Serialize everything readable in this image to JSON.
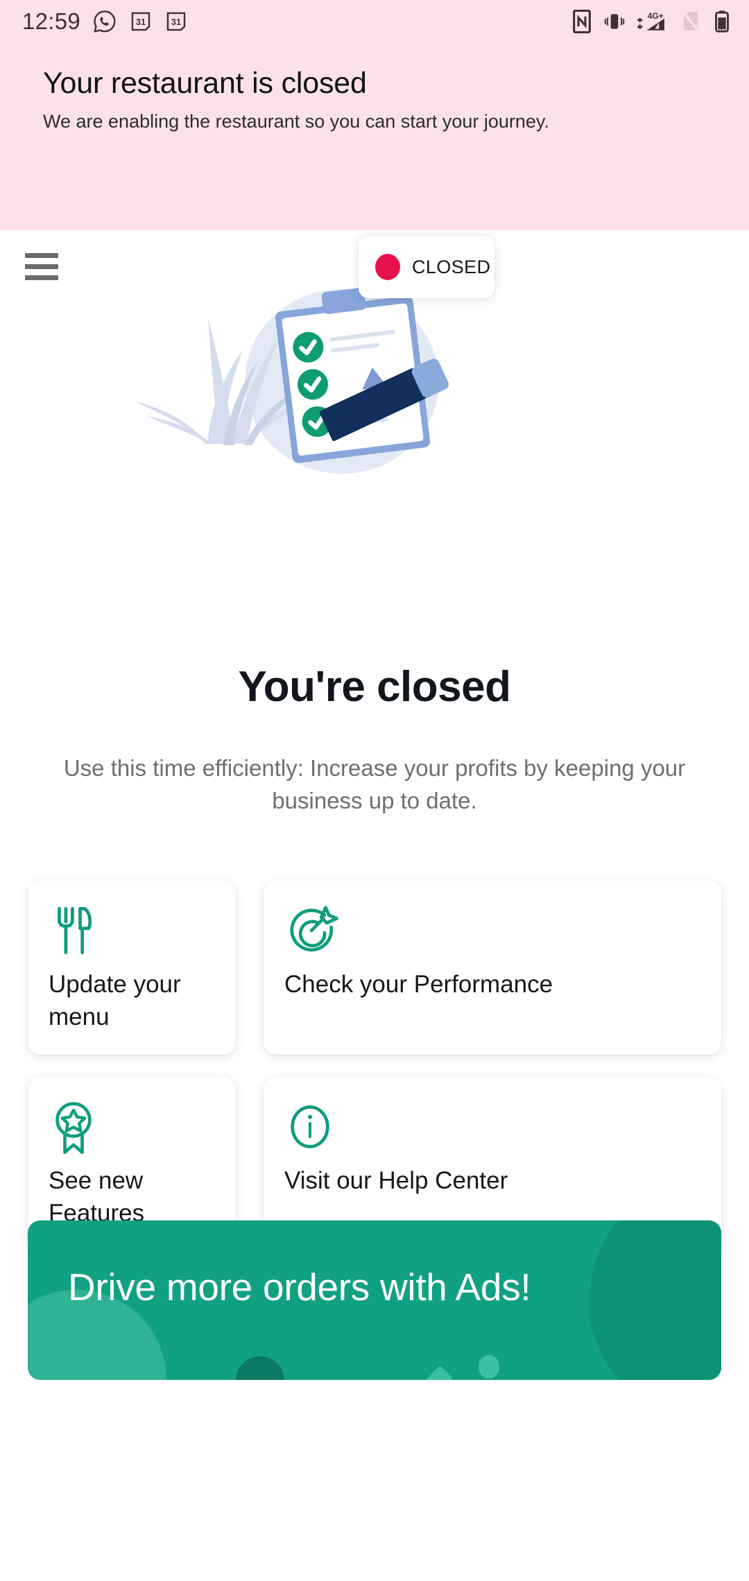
{
  "status_bar": {
    "time": "12:59",
    "left_icons": [
      {
        "name": "whatsapp-icon",
        "label": "WhatsApp"
      },
      {
        "name": "calendar-icon",
        "label": "31"
      },
      {
        "name": "calendar-icon-2",
        "label": "31"
      }
    ],
    "right_icons": [
      {
        "name": "nfc-icon",
        "label": "NFC"
      },
      {
        "name": "vibrate-icon",
        "label": "Vibrate"
      },
      {
        "name": "signal-4g-icon",
        "label": "4G+"
      },
      {
        "name": "no-sim-icon",
        "label": "No SIM"
      },
      {
        "name": "battery-icon",
        "label": "Battery"
      }
    ]
  },
  "banner": {
    "title": "Your restaurant is closed",
    "subtitle": "We are enabling the restaurant so you can start your journey.",
    "background_color": "#fbe1e9"
  },
  "header": {
    "menu_icon": "hamburger-menu-icon",
    "store_icon": "store-clock-icon",
    "status_pill": {
      "label": "CLOSED",
      "dot_color": "#e8114b"
    }
  },
  "illustration": {
    "name": "clipboard-checklist-illustration",
    "elements": [
      "plant",
      "clipboard",
      "three-green-checkmarks",
      "pencil"
    ],
    "accent_color": "#0c9a74",
    "blue_color": "#7a9bd4"
  },
  "main": {
    "title": "You're closed",
    "subtitle": "Use this time efficiently: Increase your profits by keeping your business up to date."
  },
  "cards": [
    {
      "icon": "fork-knife-icon",
      "label": "Update your menu"
    },
    {
      "icon": "target-arrow-icon",
      "label": "Check your Performance"
    },
    {
      "icon": "award-star-icon",
      "label": "See new Features"
    },
    {
      "icon": "info-circle-icon",
      "label": "Visit our Help Center"
    }
  ],
  "promo": {
    "text": "Drive more orders with Ads!",
    "background_color": "#10a182"
  },
  "theme": {
    "accent_teal": "#0f9d7d",
    "text_primary": "#15171b",
    "text_secondary": "#6e6e73"
  }
}
